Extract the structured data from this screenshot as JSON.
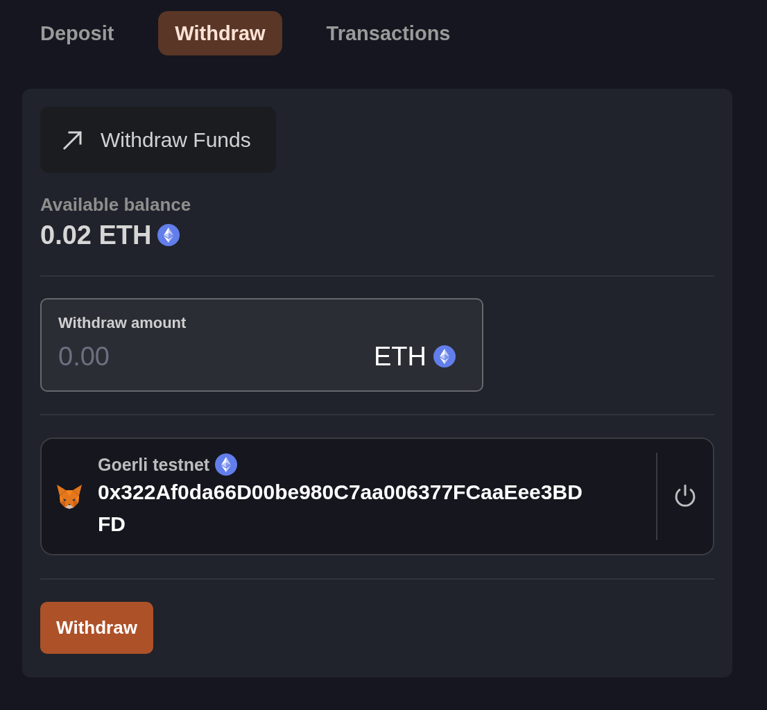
{
  "tabs": [
    {
      "label": "Deposit",
      "selected": false
    },
    {
      "label": "Withdraw",
      "selected": true
    },
    {
      "label": "Transactions",
      "selected": false
    }
  ],
  "panel": {
    "title": "Withdraw Funds"
  },
  "balance": {
    "label": "Available balance",
    "amount": "0.02 ETH"
  },
  "amount_field": {
    "label": "Withdraw amount",
    "placeholder": "0.00",
    "currency": "ETH"
  },
  "wallet": {
    "network": "Goerli testnet",
    "address": "0x322Af0da66D00be980C7aa006377FCaaEee3BDFD"
  },
  "submit_button": {
    "label": "Withdraw"
  }
}
